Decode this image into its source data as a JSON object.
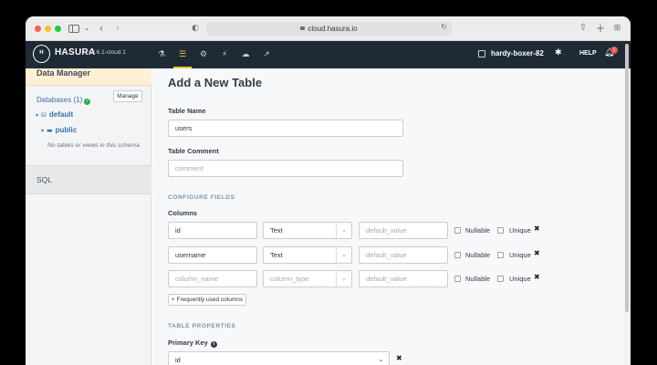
{
  "browser": {
    "url": "cloud.hasura.io"
  },
  "topnav": {
    "logo_text": "HASURA",
    "version": "v2.6.1-cloud.1",
    "project": "hardy-boxer-82",
    "help": "HELP",
    "notification_count": "1",
    "nav_icons": [
      "flask-icon",
      "database-icon",
      "remote-schema-icon",
      "actions-icon",
      "cloud-icon",
      "chart-icon"
    ]
  },
  "sidebar": {
    "title": "Data Manager",
    "databases_label": "Databases (1)",
    "manage_label": "Manage",
    "db_name": "default",
    "schema_name": "public",
    "empty_text": "No tables or views in this schema",
    "sql_label": "SQL"
  },
  "main": {
    "title": "Add a New Table",
    "table_name_label": "Table Name",
    "table_name_value": "users",
    "table_comment_label": "Table Comment",
    "table_comment_placeholder": "comment",
    "configure_fields": "CONFIGURE FIELDS",
    "columns_label": "Columns",
    "columns": [
      {
        "name": "id",
        "type": "Text",
        "default": "default_value",
        "name_is_placeholder": false,
        "type_is_placeholder": false
      },
      {
        "name": "username",
        "type": "Text",
        "default": "default_value",
        "name_is_placeholder": false,
        "type_is_placeholder": false
      },
      {
        "name": "column_name",
        "type": "column_type",
        "default": "default_value",
        "name_is_placeholder": true,
        "type_is_placeholder": true
      }
    ],
    "nullable_label": "Nullable",
    "unique_label": "Unique",
    "frequent_columns_label": "+ Frequently used columns",
    "table_properties": "TABLE PROPERTIES",
    "primary_key_label": "Primary Key",
    "primary_key_value": "id"
  },
  "colors": {
    "nav_bg": "#1f2a37",
    "accent": "#f8c43a",
    "link": "#3b6fa8"
  }
}
